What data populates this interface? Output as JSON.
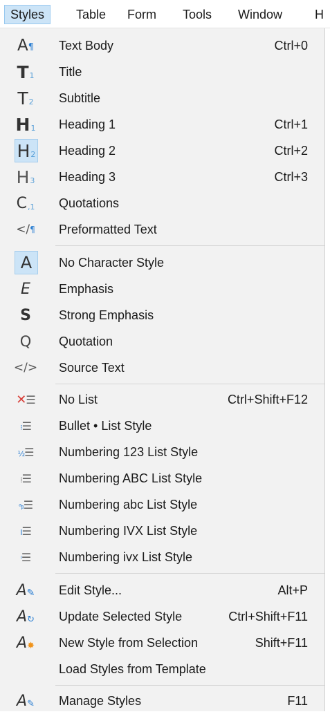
{
  "menubar": {
    "items": [
      "Styles",
      "Table",
      "Form",
      "Tools",
      "Window",
      "He"
    ]
  },
  "menu": {
    "paragraph_styles": [
      {
        "label": "Text Body",
        "shortcut": "Ctrl+0",
        "icon": "paragraph-style-icon"
      },
      {
        "label": "Title",
        "shortcut": "",
        "icon": "title-style-icon"
      },
      {
        "label": "Subtitle",
        "shortcut": "",
        "icon": "subtitle-style-icon"
      },
      {
        "label": "Heading 1",
        "shortcut": "Ctrl+1",
        "icon": "heading-1-icon"
      },
      {
        "label": "Heading 2",
        "shortcut": "Ctrl+2",
        "icon": "heading-2-icon"
      },
      {
        "label": "Heading 3",
        "shortcut": "Ctrl+3",
        "icon": "heading-3-icon"
      },
      {
        "label": "Quotations",
        "shortcut": "",
        "icon": "quotations-icon"
      },
      {
        "label": "Preformatted Text",
        "shortcut": "",
        "icon": "preformatted-text-icon"
      }
    ],
    "character_styles": [
      {
        "label": "No Character Style",
        "shortcut": "",
        "icon": "no-character-style-icon"
      },
      {
        "label": "Emphasis",
        "shortcut": "",
        "icon": "emphasis-icon"
      },
      {
        "label": "Strong Emphasis",
        "shortcut": "",
        "icon": "strong-emphasis-icon"
      },
      {
        "label": "Quotation",
        "shortcut": "",
        "icon": "quotation-icon"
      },
      {
        "label": "Source Text",
        "shortcut": "",
        "icon": "source-text-icon"
      }
    ],
    "list_styles": [
      {
        "label": "No List",
        "shortcut": "Ctrl+Shift+F12",
        "icon": "no-list-icon"
      },
      {
        "label": "Bullet • List Style",
        "shortcut": "",
        "icon": "bullet-list-icon"
      },
      {
        "label": "Numbering 123 List Style",
        "shortcut": "",
        "icon": "numbering-123-icon"
      },
      {
        "label": "Numbering ABC List Style",
        "shortcut": "",
        "icon": "numbering-abc-upper-icon"
      },
      {
        "label": "Numbering abc List Style",
        "shortcut": "",
        "icon": "numbering-abc-lower-icon"
      },
      {
        "label": "Numbering IVX List Style",
        "shortcut": "",
        "icon": "numbering-ivx-upper-icon"
      },
      {
        "label": "Numbering ivx List Style",
        "shortcut": "",
        "icon": "numbering-ivx-lower-icon"
      }
    ],
    "style_actions": [
      {
        "label": "Edit Style...",
        "shortcut": "Alt+P",
        "icon": "edit-style-icon"
      },
      {
        "label": "Update Selected Style",
        "shortcut": "Ctrl+Shift+F11",
        "icon": "update-style-icon"
      },
      {
        "label": "New Style from Selection",
        "shortcut": "Shift+F11",
        "icon": "new-style-icon"
      },
      {
        "label": "Load Styles from Template",
        "shortcut": "",
        "icon": ""
      }
    ],
    "manage": [
      {
        "label": "Manage Styles",
        "shortcut": "F11",
        "icon": "manage-styles-icon"
      }
    ]
  },
  "colors": {
    "highlight": "#cce4f7",
    "menu_background": "#f2f2f2",
    "icon_accent": "#2a7ed2"
  }
}
